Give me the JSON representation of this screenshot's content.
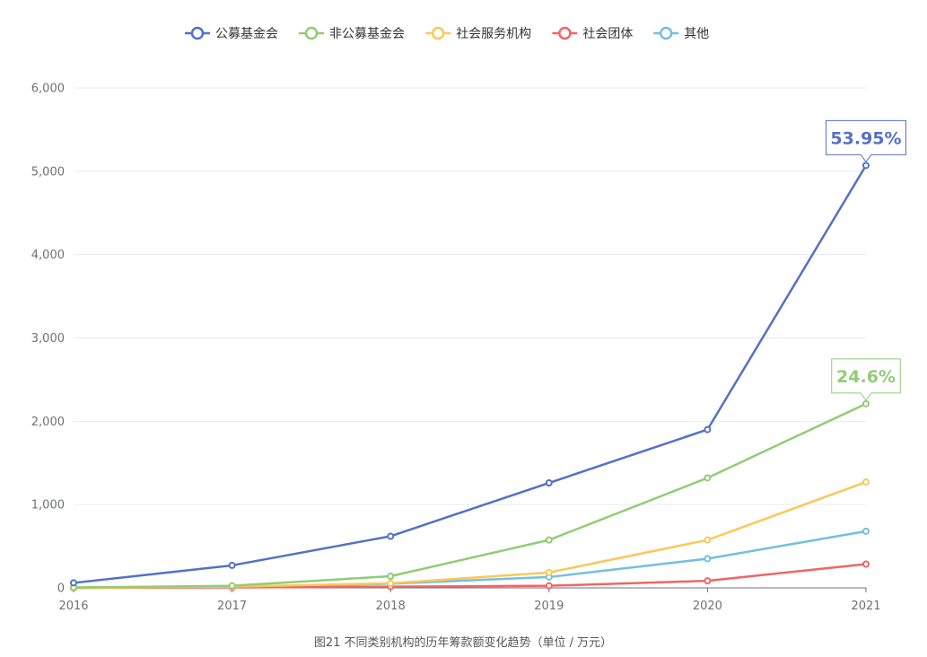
{
  "chart_data": {
    "type": "line",
    "title": "",
    "caption": "图21  不同类别机构的历年筹款额变化趋势（单位 / 万元）",
    "xlabel": "",
    "ylabel": "",
    "x": [
      "2016",
      "2017",
      "2018",
      "2019",
      "2020",
      "2021"
    ],
    "ylim": [
      0,
      6000
    ],
    "yticks": [
      0,
      1000,
      2000,
      3000,
      4000,
      5000,
      6000
    ],
    "ytick_labels": [
      "0",
      "1,000",
      "2,000",
      "3,000",
      "4,000",
      "5,000",
      "6,000"
    ],
    "grid": true,
    "legend_position": "top-center",
    "series": [
      {
        "name": "公募基金会",
        "color": "#5470c6",
        "values": [
          60,
          270,
          620,
          1260,
          1900,
          5070
        ]
      },
      {
        "name": "非公募基金会",
        "color": "#91cc75",
        "values": [
          5,
          25,
          140,
          575,
          1320,
          2210
        ]
      },
      {
        "name": "社会服务机构",
        "color": "#fac858",
        "values": [
          0,
          15,
          55,
          185,
          575,
          1270
        ]
      },
      {
        "name": "社会团体",
        "color": "#ee6666",
        "values": [
          0,
          5,
          15,
          25,
          85,
          285
        ]
      },
      {
        "name": "其他",
        "color": "#73c0de",
        "values": [
          0,
          10,
          50,
          130,
          350,
          680
        ]
      }
    ],
    "annotations": [
      {
        "series": 0,
        "point": 5,
        "text": "53.95%",
        "color": "#5470c6"
      },
      {
        "series": 1,
        "point": 5,
        "text": "24.6%",
        "color": "#91cc75"
      }
    ]
  }
}
